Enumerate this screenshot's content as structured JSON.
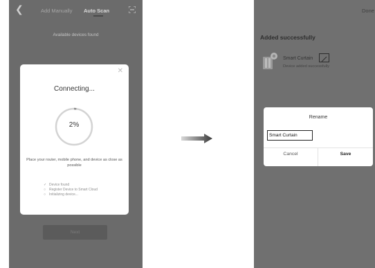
{
  "left_screen": {
    "back_icon": "chevron-left-icon",
    "tabs": [
      {
        "label": "Add Manually",
        "active": false
      },
      {
        "label": "Auto Scan",
        "active": true
      }
    ],
    "scan_icon": "scan-frame-icon",
    "available_text": "Available devices found",
    "modal": {
      "close_icon": "close-icon",
      "title": "Connecting...",
      "progress_text": "2%",
      "progress_value": 0.02,
      "hint": "Place your router, mobile phone, and device as close as possible",
      "steps": [
        {
          "label": "Device found",
          "status": "done"
        },
        {
          "label": "Register Device to Smart Cloud",
          "status": "pending"
        },
        {
          "label": "Initializing device...",
          "status": "pending"
        }
      ]
    },
    "next_label": "Next"
  },
  "arrow_icon": "arrow-right-icon",
  "right_screen": {
    "done_label": "Done",
    "title": "Added successfully",
    "device": {
      "name": "Smart Curtain",
      "status": "Device added successfully",
      "icon": "curtain-device-icon",
      "edit_icon": "pencil-icon"
    },
    "rename_dialog": {
      "title": "Rename",
      "input_value": "Smart Curtain",
      "cancel_label": "Cancel",
      "save_label": "Save"
    }
  },
  "colors": {
    "overlay_dark": "#6b6b6b",
    "modal_bg": "#ffffff",
    "progress_ring": "#cfcfcf"
  }
}
